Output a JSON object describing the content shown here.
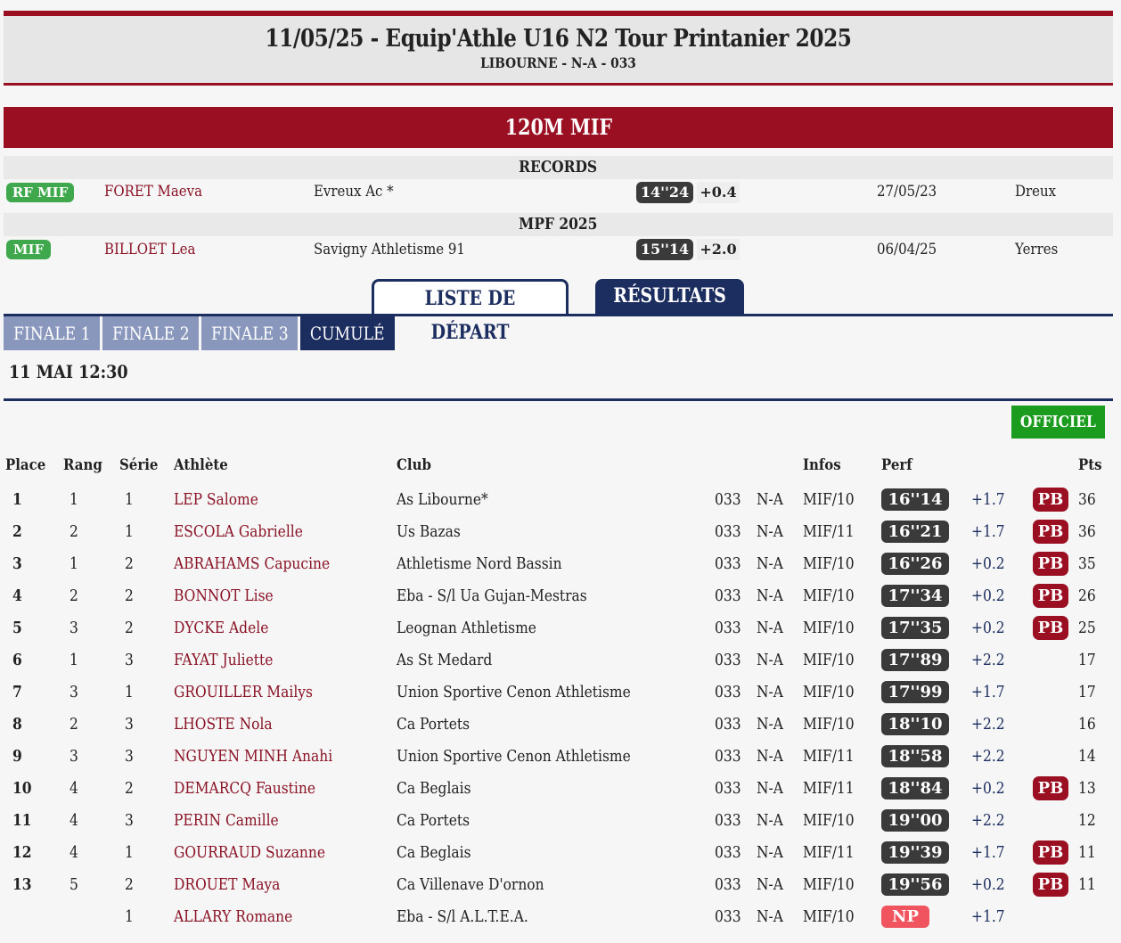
{
  "header": {
    "title": "11/05/25 - Equip'Athle U16 N2 Tour Printanier 2025",
    "subtitle": "LIBOURNE - N-A - 033"
  },
  "event": {
    "name": "120M MIF"
  },
  "records": {
    "section_title": "RECORDS",
    "row": {
      "badge": "RF MIF",
      "athlete": "FORET Maeva",
      "club": "Evreux Ac *",
      "perf": "14''24",
      "wind": "+0.4",
      "date": "27/05/23",
      "place": "Dreux"
    }
  },
  "best": {
    "section_title": "MPF 2025",
    "row": {
      "badge": "MIF",
      "athlete": "BILLOET Lea",
      "club": "Savigny Athletisme 91",
      "perf": "15''14",
      "wind": "+2.0",
      "date": "06/04/25",
      "place": "Yerres"
    }
  },
  "tabs": {
    "start_list": "LISTE DE DÉPART",
    "results": "RÉSULTATS"
  },
  "subtabs": [
    "FINALE 1",
    "FINALE 2",
    "FINALE 3",
    "CUMULÉ"
  ],
  "datetime": "11 MAI 12:30",
  "status": "OFFICIEL",
  "columns": {
    "place": "Place",
    "rang": "Rang",
    "serie": "Série",
    "athlete": "Athlète",
    "club": "Club",
    "infos": "Infos",
    "perf": "Perf",
    "pts": "Pts"
  },
  "results": [
    {
      "place": "1",
      "rang": "1",
      "serie": "1",
      "athlete": "LEP Salome",
      "club": "As Libourne*",
      "dep": "033",
      "region": "N-A",
      "cat": "MIF/10",
      "perf": "16''14",
      "wind": "+1.7",
      "pb": "PB",
      "pts": "36"
    },
    {
      "place": "2",
      "rang": "2",
      "serie": "1",
      "athlete": "ESCOLA Gabrielle",
      "club": "Us Bazas",
      "dep": "033",
      "region": "N-A",
      "cat": "MIF/11",
      "perf": "16''21",
      "wind": "+1.7",
      "pb": "PB",
      "pts": "36"
    },
    {
      "place": "3",
      "rang": "1",
      "serie": "2",
      "athlete": "ABRAHAMS Capucine",
      "club": "Athletisme Nord Bassin",
      "dep": "033",
      "region": "N-A",
      "cat": "MIF/10",
      "perf": "16''26",
      "wind": "+0.2",
      "pb": "PB",
      "pts": "35"
    },
    {
      "place": "4",
      "rang": "2",
      "serie": "2",
      "athlete": "BONNOT Lise",
      "club": "Eba - S/l Ua Gujan-Mestras",
      "dep": "033",
      "region": "N-A",
      "cat": "MIF/10",
      "perf": "17''34",
      "wind": "+0.2",
      "pb": "PB",
      "pts": "26"
    },
    {
      "place": "5",
      "rang": "3",
      "serie": "2",
      "athlete": "DYCKE Adele",
      "club": "Leognan Athletisme",
      "dep": "033",
      "region": "N-A",
      "cat": "MIF/10",
      "perf": "17''35",
      "wind": "+0.2",
      "pb": "PB",
      "pts": "25"
    },
    {
      "place": "6",
      "rang": "1",
      "serie": "3",
      "athlete": "FAYAT Juliette",
      "club": "As St Medard",
      "dep": "033",
      "region": "N-A",
      "cat": "MIF/10",
      "perf": "17''89",
      "wind": "+2.2",
      "pb": "",
      "pts": "17"
    },
    {
      "place": "7",
      "rang": "3",
      "serie": "1",
      "athlete": "GROUILLER Mailys",
      "club": "Union Sportive Cenon Athletisme",
      "dep": "033",
      "region": "N-A",
      "cat": "MIF/10",
      "perf": "17''99",
      "wind": "+1.7",
      "pb": "",
      "pts": "17"
    },
    {
      "place": "8",
      "rang": "2",
      "serie": "3",
      "athlete": "LHOSTE Nola",
      "club": "Ca Portets",
      "dep": "033",
      "region": "N-A",
      "cat": "MIF/10",
      "perf": "18''10",
      "wind": "+2.2",
      "pb": "",
      "pts": "16"
    },
    {
      "place": "9",
      "rang": "3",
      "serie": "3",
      "athlete": "NGUYEN MINH Anahi",
      "club": "Union Sportive Cenon Athletisme",
      "dep": "033",
      "region": "N-A",
      "cat": "MIF/11",
      "perf": "18''58",
      "wind": "+2.2",
      "pb": "",
      "pts": "14"
    },
    {
      "place": "10",
      "rang": "4",
      "serie": "2",
      "athlete": "DEMARCQ Faustine",
      "club": "Ca Beglais",
      "dep": "033",
      "region": "N-A",
      "cat": "MIF/11",
      "perf": "18''84",
      "wind": "+0.2",
      "pb": "PB",
      "pts": "13"
    },
    {
      "place": "11",
      "rang": "4",
      "serie": "3",
      "athlete": "PERIN Camille",
      "club": "Ca Portets",
      "dep": "033",
      "region": "N-A",
      "cat": "MIF/10",
      "perf": "19''00",
      "wind": "+2.2",
      "pb": "",
      "pts": "12"
    },
    {
      "place": "12",
      "rang": "4",
      "serie": "1",
      "athlete": "GOURRAUD Suzanne",
      "club": "Ca Beglais",
      "dep": "033",
      "region": "N-A",
      "cat": "MIF/11",
      "perf": "19''39",
      "wind": "+1.7",
      "pb": "PB",
      "pts": "11"
    },
    {
      "place": "13",
      "rang": "5",
      "serie": "2",
      "athlete": "DROUET Maya",
      "club": "Ca Villenave D'ornon",
      "dep": "033",
      "region": "N-A",
      "cat": "MIF/10",
      "perf": "19''56",
      "wind": "+0.2",
      "pb": "PB",
      "pts": "11"
    },
    {
      "place": "",
      "rang": "",
      "serie": "1",
      "athlete": "ALLARY Romane",
      "club": "Eba - S/l A.L.T.E.A.",
      "dep": "033",
      "region": "N-A",
      "cat": "MIF/10",
      "perf": "NP",
      "wind": "+1.7",
      "pb": "",
      "pts": ""
    }
  ]
}
